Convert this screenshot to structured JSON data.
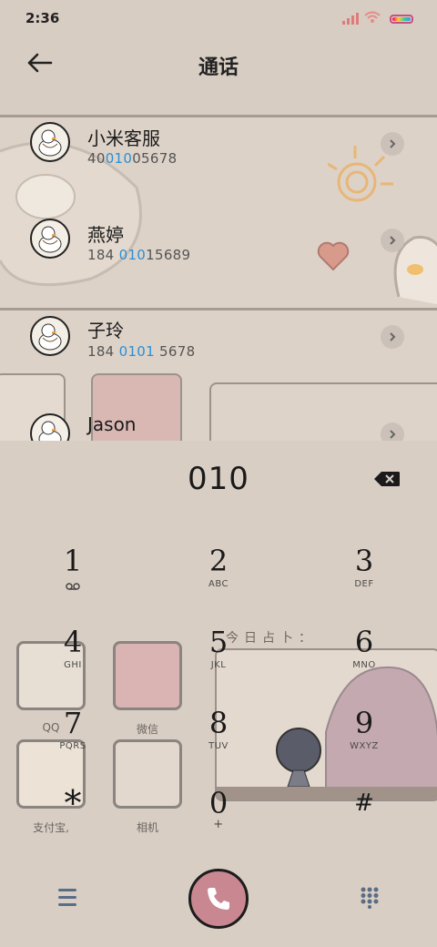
{
  "status": {
    "time": "2:36"
  },
  "header": {
    "title": "通话"
  },
  "contacts": [
    {
      "name": "小米客服",
      "num_pre": "40",
      "num_hl": "010",
      "num_post": "05678"
    },
    {
      "name": "燕婷",
      "num_pre": "184 ",
      "num_hl": "010",
      "num_post": "15689"
    },
    {
      "name": "子玲",
      "num_pre": "184 ",
      "num_hl": "0101",
      "num_post": " 5678"
    },
    {
      "name": "Jason",
      "num_pre": "",
      "num_hl": "",
      "num_post": ""
    }
  ],
  "dialer": {
    "input": "010",
    "keys": [
      {
        "digit": "1",
        "letters": ""
      },
      {
        "digit": "2",
        "letters": "ABC"
      },
      {
        "digit": "3",
        "letters": "DEF"
      },
      {
        "digit": "4",
        "letters": "GHI"
      },
      {
        "digit": "5",
        "letters": "JKL"
      },
      {
        "digit": "6",
        "letters": "MNO"
      },
      {
        "digit": "7",
        "letters": "PQRS"
      },
      {
        "digit": "8",
        "letters": "TUV"
      },
      {
        "digit": "9",
        "letters": "WXYZ"
      },
      {
        "digit": "*",
        "letters": ""
      },
      {
        "digit": "0",
        "letters": "+"
      },
      {
        "digit": "#",
        "letters": ""
      }
    ]
  },
  "wallpaper": {
    "fortune": "今日占卜：",
    "icons": [
      {
        "label": "QQ"
      },
      {
        "label": "微信"
      },
      {
        "label": "支付宝,"
      },
      {
        "label": "相机"
      }
    ]
  },
  "colors": {
    "highlight": "#2b8fd6",
    "call_button": "#c98791",
    "background": "#d8cdc3"
  },
  "icons": {
    "back": "arrow-left-icon",
    "backspace": "backspace-icon",
    "call": "phone-icon",
    "menu": "hamburger-icon",
    "dialpad": "dialpad-icon",
    "chevron": "chevron-right-icon"
  }
}
